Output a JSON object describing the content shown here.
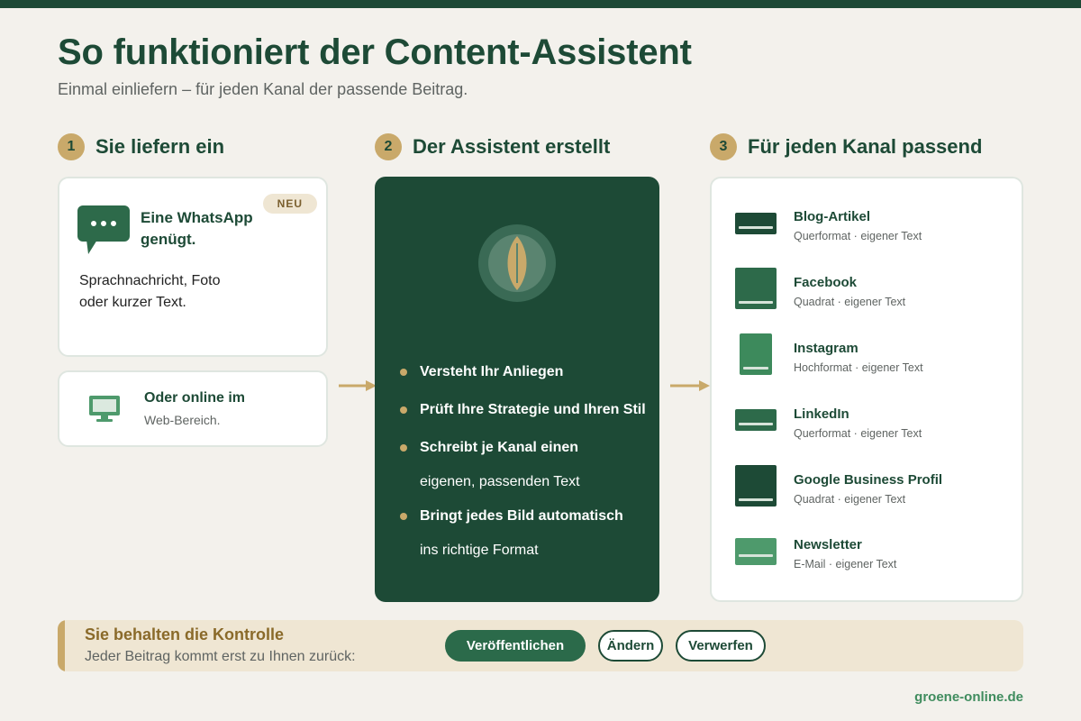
{
  "header": {
    "title": "So funktioniert der Content-Assistent",
    "subtitle": "Einmal einliefern – für jeden Kanal der passende Beitrag."
  },
  "steps": [
    {
      "number": "1",
      "title": "Sie liefern ein"
    },
    {
      "number": "2",
      "title": "Der Assistent erstellt"
    },
    {
      "number": "3",
      "title": "Für jeden Kanal passend"
    }
  ],
  "input": {
    "whatsapp": {
      "badge": "NEU",
      "title": "Eine WhatsApp genügt.",
      "description_line1": "Sprachnachricht, Foto",
      "description_line2": "oder kurzer Text.",
      "icon": "chat-bubble-icon"
    },
    "web": {
      "title": "Oder online im",
      "subtitle": "Web-Bereich.",
      "icon": "monitor-icon"
    }
  },
  "assistant": {
    "icon": "leaf-icon",
    "points": [
      {
        "strong": "Versteht Ihr Anliegen",
        "light": ""
      },
      {
        "strong": "Prüft Ihre Strategie und Ihren Stil",
        "light": ""
      },
      {
        "strong": "Schreibt je Kanal einen",
        "light": "eigenen, passenden Text"
      },
      {
        "strong": "Bringt jedes Bild automatisch",
        "light": "ins richtige Format"
      }
    ]
  },
  "channels": [
    {
      "name": "Blog-Artikel",
      "meta": "Querformat · eigener Text",
      "format": "landscape",
      "color": "#1d4a36"
    },
    {
      "name": "Facebook",
      "meta": "Quadrat · eigener Text",
      "format": "square",
      "color": "#2d6a4a"
    },
    {
      "name": "Instagram",
      "meta": "Hochformat · eigener Text",
      "format": "portrait",
      "color": "#3d8a5c"
    },
    {
      "name": "LinkedIn",
      "meta": "Querformat · eigener Text",
      "format": "landscape",
      "color": "#2d6a4a"
    },
    {
      "name": "Google Business Profil",
      "meta": "Quadrat · eigener Text",
      "format": "square",
      "color": "#1d4a36"
    },
    {
      "name": "Newsletter",
      "meta": "E-Mail · eigener Text",
      "format": "wide",
      "color": "#4e9a6c"
    }
  ],
  "control": {
    "title": "Sie behalten die Kontrolle",
    "subtitle": "Jeder Beitrag kommt erst zu Ihnen zurück:",
    "buttons": {
      "publish": "Veröffentlichen",
      "change": "Ändern",
      "discard": "Verwerfen"
    }
  },
  "footer": {
    "url": "groene-online.de"
  },
  "colors": {
    "brand_dark": "#1d4a36",
    "accent_gold": "#c9a96a",
    "background": "#f3f1ec",
    "link_green": "#3f8c5e"
  }
}
